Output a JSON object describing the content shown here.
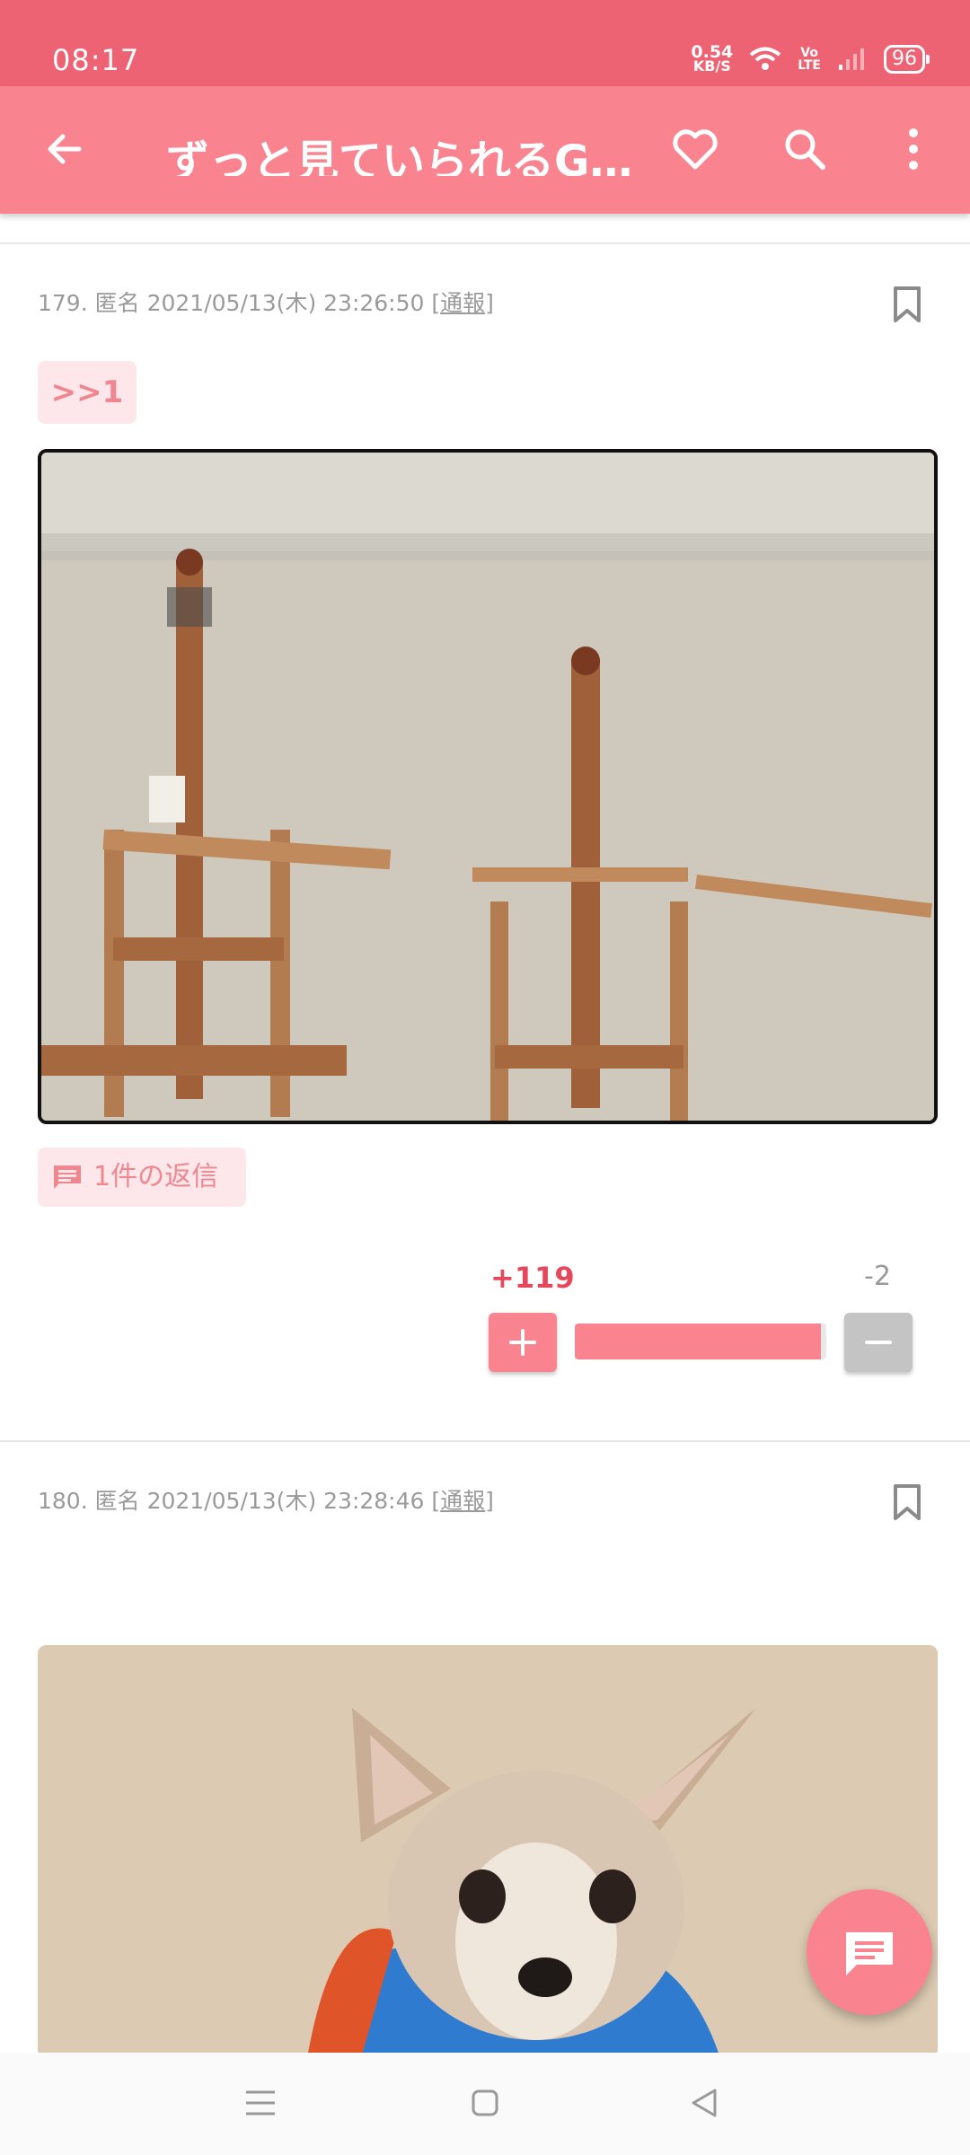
{
  "status_bar": {
    "time": "08:17",
    "net_speed_value": "0.54",
    "net_speed_unit": "KB/S",
    "volte_top": "Vo",
    "volte_bottom": "LTE",
    "battery": "96"
  },
  "app_bar": {
    "title": "ずっと見ていられるGIF画像",
    "icons": [
      "back-arrow-icon",
      "heart-icon",
      "search-icon",
      "more-vert-icon"
    ]
  },
  "posts": [
    {
      "number": "179.",
      "author": "匿名",
      "datetime": "2021/05/13(木) 23:26:50",
      "report_open": "[",
      "report_label": "通報",
      "report_close": "]",
      "anchor": ">>1",
      "replies_label": "1件の返信",
      "votes": {
        "plus": "+119",
        "minus": "-2",
        "plus_ratio": 0.98
      }
    },
    {
      "number": "180.",
      "author": "匿名",
      "datetime": "2021/05/13(木) 23:28:46",
      "report_open": "[",
      "report_label": "通報",
      "report_close": "]"
    }
  ],
  "colors": {
    "status_bar": "#ee6373",
    "app_bar": "#f9848f",
    "accent": "#f9848f",
    "plus_count": "#e6475a",
    "chip_bg": "#fde7ea"
  }
}
